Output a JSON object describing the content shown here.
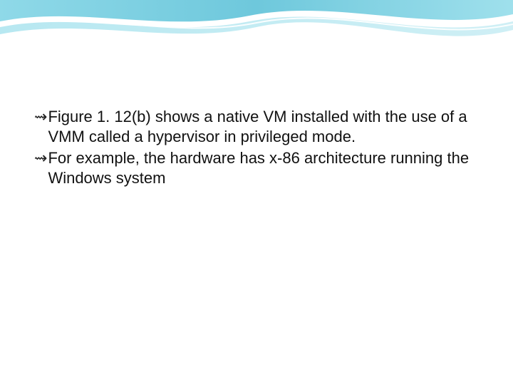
{
  "bullets": [
    {
      "glyph": "⇝",
      "text": "Figure 1. 12(b) shows a native VM installed with the use of a VMM called a hypervisor in privileged mode."
    },
    {
      "glyph": "⇝",
      "text": "For example, the hardware has x-86 architecture running the Windows system"
    }
  ]
}
